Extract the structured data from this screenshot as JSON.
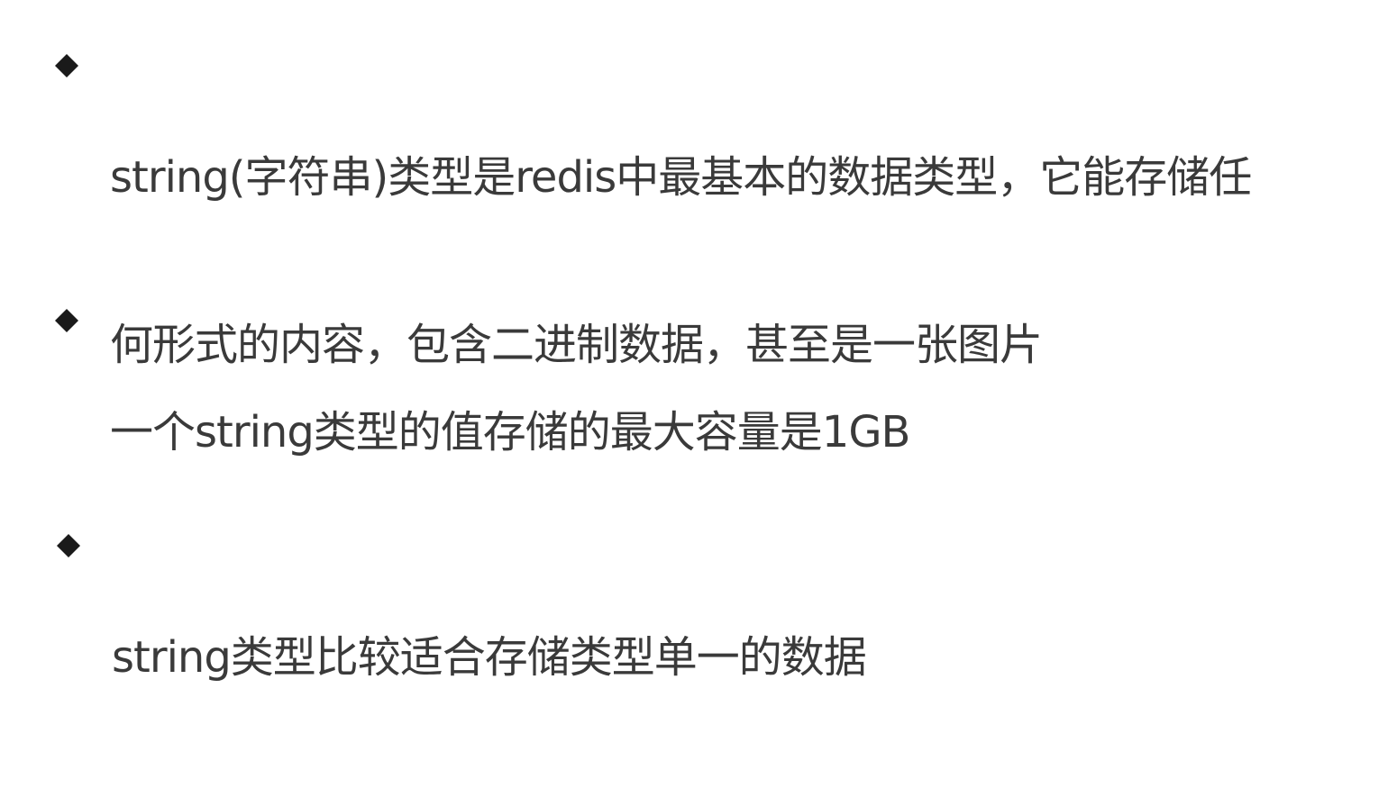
{
  "bullets": [
    {
      "icon": "diamond-bullet-icon",
      "lines": [
        "string(字符串)类型是redis中最基本的数据类型，它能存储任",
        "何形式的内容，包含二进制数据，甚至是一张图片"
      ]
    },
    {
      "icon": "diamond-bullet-icon",
      "lines": [
        "一个string类型的值存储的最大容量是1GB"
      ]
    },
    {
      "icon": "diamond-bullet-icon",
      "lines": [
        "string类型比较适合存储类型单一的数据"
      ]
    }
  ],
  "colors": {
    "text": "#3a3a3a",
    "bullet": "#1a1a1a",
    "background": "#ffffff"
  }
}
